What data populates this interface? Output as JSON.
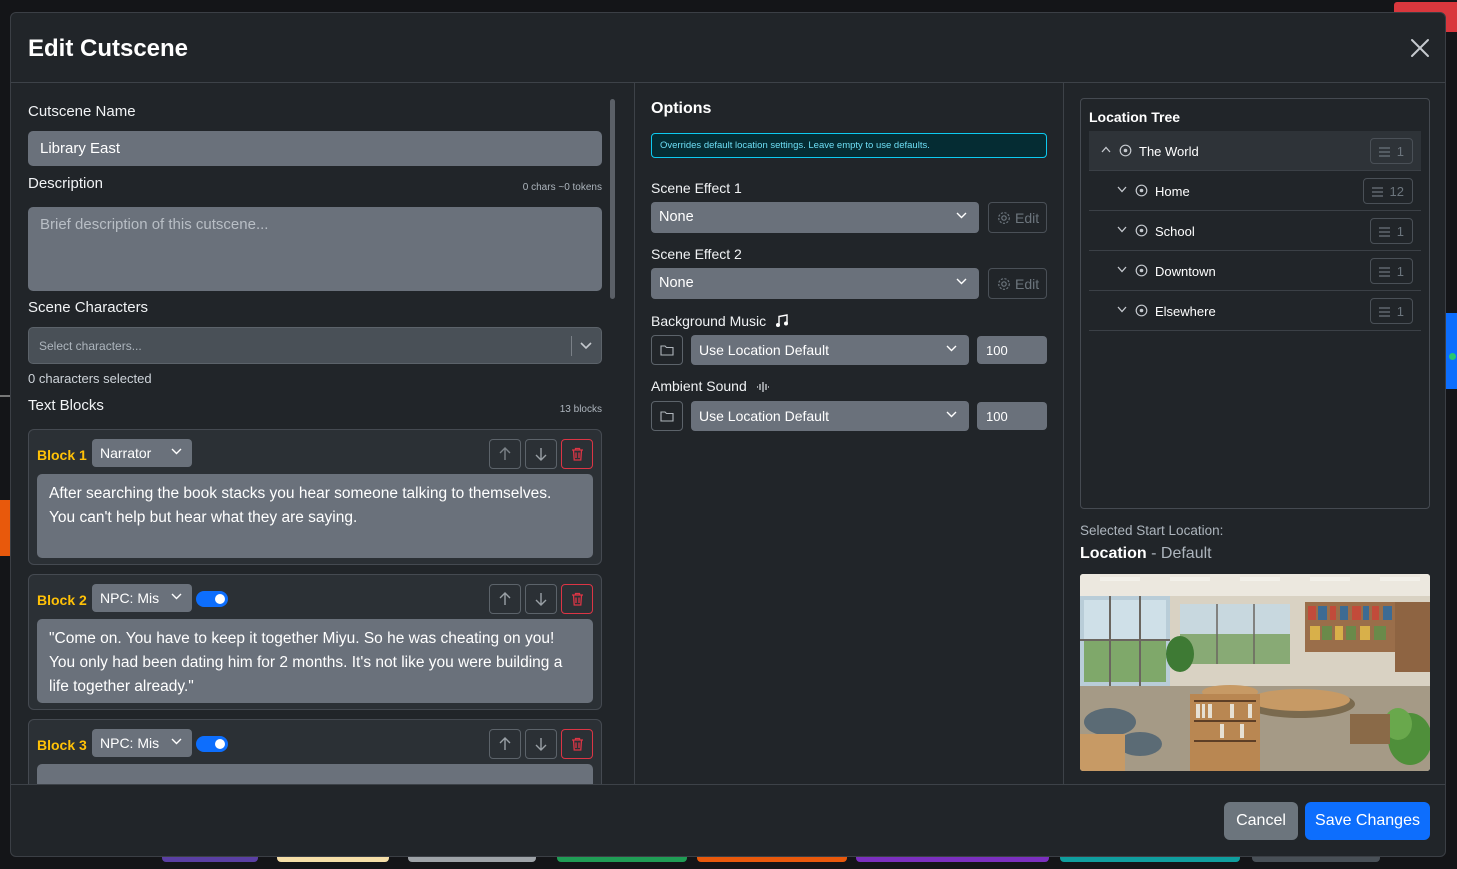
{
  "modal": {
    "title": "Edit Cutscene",
    "close_icon": "close-icon"
  },
  "left": {
    "name_label": "Cutscene Name",
    "name_value": "Library East",
    "description_label": "Description",
    "description_count": "0 chars ~0 tokens",
    "description_placeholder": "Brief description of this cutscene...",
    "characters_label": "Scene Characters",
    "characters_placeholder": "Select characters...",
    "characters_selected": "0 characters selected",
    "text_blocks_label": "Text Blocks",
    "text_blocks_count": "13 blocks",
    "blocks": [
      {
        "label": "Block 1",
        "speaker": "Narrator",
        "has_toggle": false,
        "text": "After searching the book stacks you hear someone talking to themselves. You can't help but hear what they are saying."
      },
      {
        "label": "Block 2",
        "speaker": "NPC: Mis",
        "has_toggle": true,
        "toggle_on": true,
        "text": "\"Come on. You have to keep it together Miyu. So he was cheating on you! You only had been dating him for 2 months. It's not like you were building a life together already.\""
      },
      {
        "label": "Block 3",
        "speaker": "NPC: Mis",
        "has_toggle": true,
        "toggle_on": true,
        "text": ""
      }
    ]
  },
  "options": {
    "title": "Options",
    "info": "Overrides default location settings. Leave empty to use defaults.",
    "scene_effect_1_label": "Scene Effect 1",
    "scene_effect_1_value": "None",
    "scene_effect_2_label": "Scene Effect 2",
    "scene_effect_2_value": "None",
    "edit_label": "Edit",
    "bg_music_label": "Background Music",
    "bg_music_value": "Use Location Default",
    "bg_music_volume": "100",
    "ambient_label": "Ambient Sound",
    "ambient_value": "Use Location Default",
    "ambient_volume": "100"
  },
  "tree": {
    "title": "Location Tree",
    "items": [
      {
        "name": "The World",
        "count": "1",
        "expanded": true
      },
      {
        "name": "Home",
        "count": "12",
        "expanded": false
      },
      {
        "name": "School",
        "count": "1",
        "expanded": false
      },
      {
        "name": "Downtown",
        "count": "1",
        "expanded": false
      },
      {
        "name": "Elsewhere",
        "count": "1",
        "expanded": false
      }
    ]
  },
  "start_location": {
    "label": "Selected Start Location:",
    "name": "Location",
    "sep": " - ",
    "mode": "Default"
  },
  "footer": {
    "cancel": "Cancel",
    "save": "Save Changes"
  },
  "colors": {
    "accent": "#0d6efd",
    "block_label": "#ffc107",
    "danger": "#dc3545",
    "info": "#0dcaf0"
  }
}
